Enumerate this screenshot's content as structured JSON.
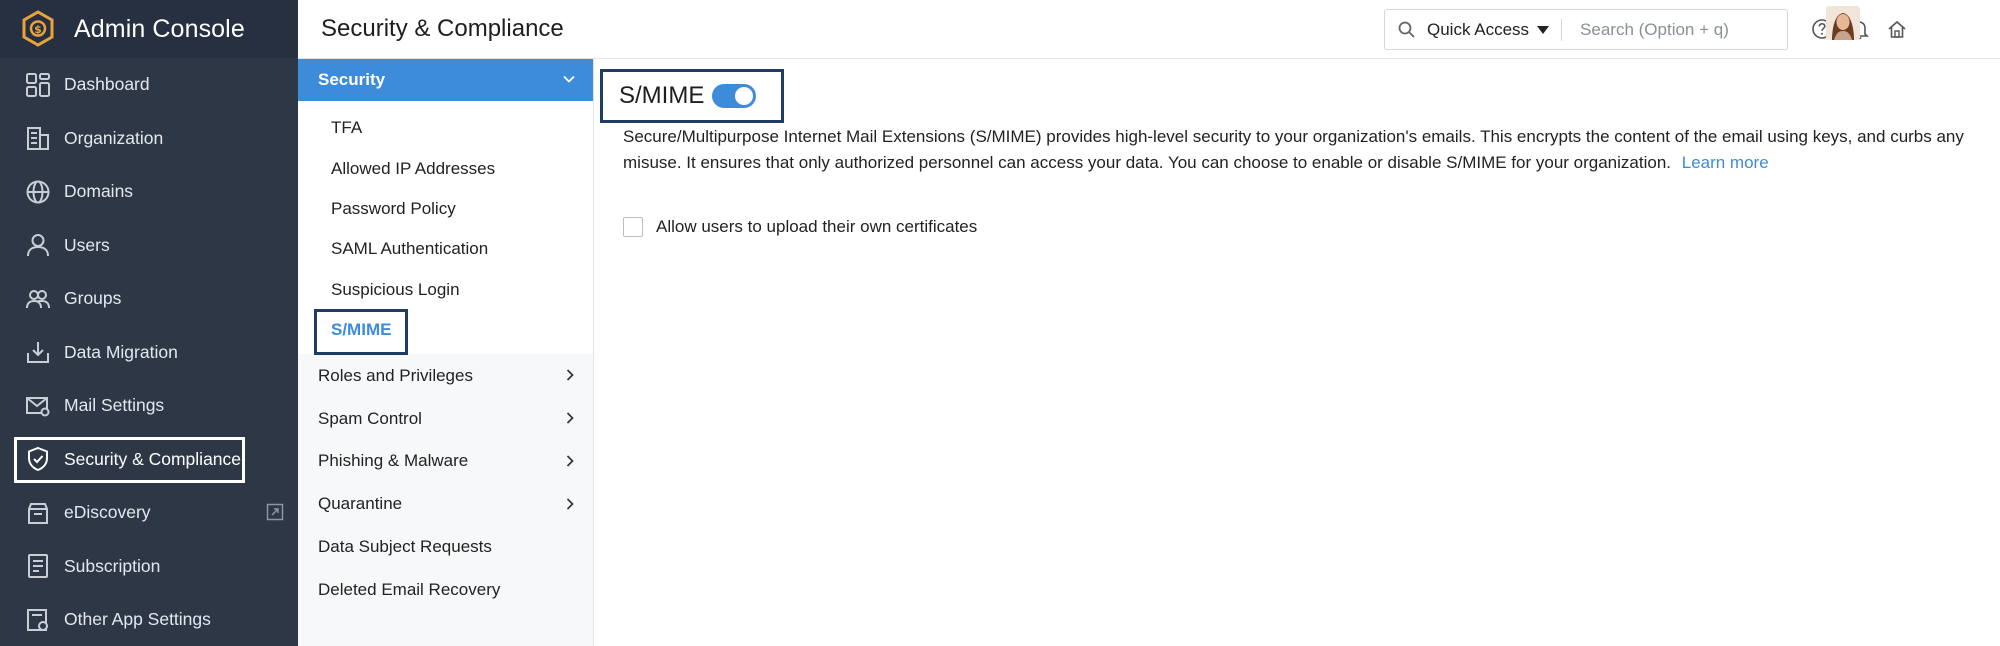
{
  "app": {
    "title": "Admin Console"
  },
  "leftnav": {
    "items": [
      {
        "label": "Dashboard",
        "icon": "dashboard-icon"
      },
      {
        "label": "Organization",
        "icon": "organization-icon"
      },
      {
        "label": "Domains",
        "icon": "globe-icon"
      },
      {
        "label": "Users",
        "icon": "user-icon"
      },
      {
        "label": "Groups",
        "icon": "groups-icon"
      },
      {
        "label": "Data Migration",
        "icon": "data-migration-icon"
      },
      {
        "label": "Mail Settings",
        "icon": "mail-settings-icon"
      },
      {
        "label": "Security & Compliance",
        "icon": "shield-icon",
        "active": true
      },
      {
        "label": "eDiscovery",
        "icon": "ediscovery-icon"
      },
      {
        "label": "Subscription",
        "icon": "subscription-icon"
      },
      {
        "label": "Other App Settings",
        "icon": "app-settings-icon"
      }
    ]
  },
  "topbar": {
    "title": "Security & Compliance",
    "quick_access": "Quick Access",
    "search_placeholder": "Search (Option + q)"
  },
  "subnav": {
    "section": "Security",
    "items": [
      "TFA",
      "Allowed IP Addresses",
      "Password Policy",
      "SAML Authentication",
      "Suspicious Login",
      "S/MIME"
    ],
    "active_item": "S/MIME",
    "groups": [
      "Roles and Privileges",
      "Spam Control",
      "Phishing & Malware",
      "Quarantine"
    ],
    "links": [
      "Data Subject Requests",
      "Deleted Email Recovery"
    ]
  },
  "main": {
    "heading": "S/MIME",
    "toggle_on": true,
    "description": "Secure/Multipurpose Internet Mail Extensions (S/MIME) provides high-level security to your organization's emails. This encrypts the content of the email using keys, and curbs any misuse. It ensures that only authorized personnel can access your data. You can choose to enable or disable S/MIME for your organization.",
    "learn_more": "Learn more",
    "checkbox_label": "Allow users to upload their own certificates",
    "checkbox_checked": false
  },
  "colors": {
    "nav_bg": "#2e3746",
    "accent": "#3d8cd9",
    "highlight_border": "#1f3d63",
    "logo": "#e8a33d"
  }
}
